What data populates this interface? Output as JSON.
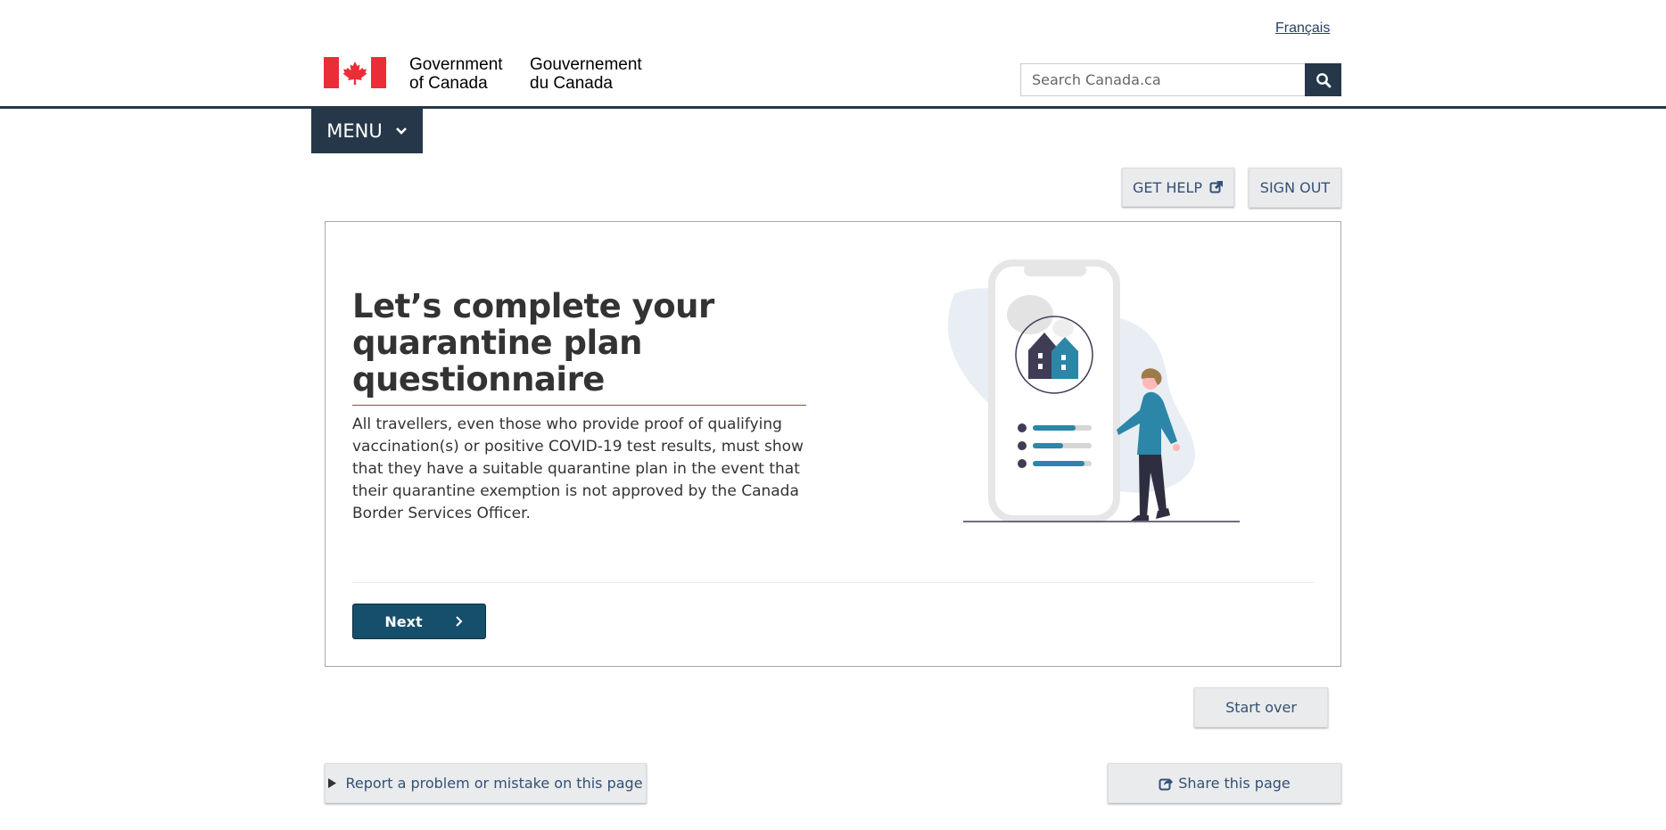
{
  "header": {
    "language_link": "Français",
    "wordmark_en_line1": "Government",
    "wordmark_en_line2": "of Canada",
    "wordmark_fr_line1": "Gouvernement",
    "wordmark_fr_line2": "du Canada",
    "search_placeholder": "Search Canada.ca",
    "search_icon": "search-icon",
    "flag_icon": "canada-flag-icon"
  },
  "menu": {
    "label": "MENU",
    "icon": "chevron-down-icon"
  },
  "actions": {
    "get_help_label": "GET HELP",
    "get_help_icon": "external-link-icon",
    "sign_out_label": "SIGN OUT"
  },
  "card": {
    "title": "Let’s complete your quarantine plan questionnaire",
    "body": "All travellers, even those who provide proof of qualifying vaccination(s) or positive COVID-19 test results, must show that they have a suitable quarantine plan in the event that their quarantine exemption is not approved by the Canada Border Services Officer.",
    "illustration": "phone-with-house-and-person-illustration",
    "next_label": "Next",
    "next_icon": "chevron-right-icon"
  },
  "footer": {
    "start_over_label": "Start over",
    "report_label": "Report a problem or mistake on this page",
    "report_icon": "triangle-right-icon",
    "share_label": "Share this page",
    "share_icon": "share-icon"
  },
  "colors": {
    "gc_navy": "#26374a",
    "flag_red": "#eb2d37",
    "next_button": "#164f6b",
    "title_rule": "#af3c43",
    "illustration_accent": "#2b86a8"
  }
}
